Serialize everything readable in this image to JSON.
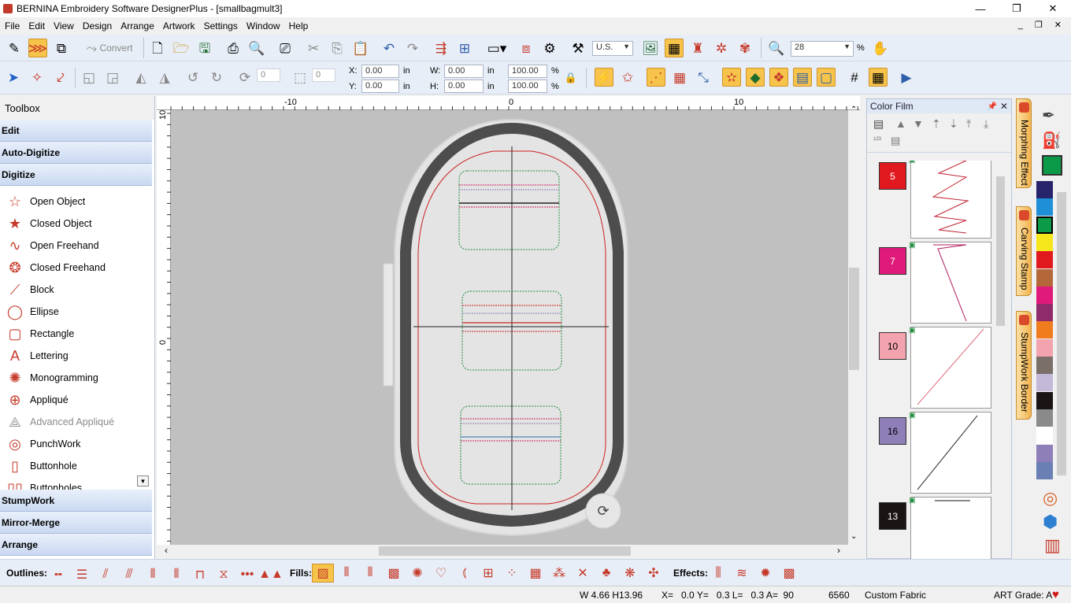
{
  "window": {
    "title": "BERNINA Embroidery Software DesignerPlus - [smallbagmult3]",
    "minimize": "—",
    "maximize": "❐",
    "close": "✕"
  },
  "menu": [
    "File",
    "Edit",
    "View",
    "Design",
    "Arrange",
    "Artwork",
    "Settings",
    "Window",
    "Help"
  ],
  "mdi_controls": "_ ❐ ✕",
  "toolbar1": {
    "convert_label": "Convert",
    "units": "U.S.",
    "zoom": "28",
    "zoom_unit": "%"
  },
  "toolbar2": {
    "x_label": "X:",
    "x_value": "0.00",
    "x_unit": "in",
    "y_label": "Y:",
    "y_value": "0.00",
    "y_unit": "in",
    "w_label": "W:",
    "w_value": "0.00",
    "w_unit": "in",
    "h_label": "H:",
    "h_value": "0.00",
    "h_unit": "in",
    "w_pct": "100.00",
    "h_pct": "100.00",
    "pct_unit": "%",
    "rotate_value": "0",
    "slant_value": "0"
  },
  "toolbox": {
    "title": "Toolbox",
    "sections_top": [
      "Edit",
      "Auto-Digitize",
      "Digitize"
    ],
    "tools": [
      {
        "label": "Open Object",
        "icon": "open-object-icon",
        "glyph": "☆",
        "disabled": false
      },
      {
        "label": "Closed Object",
        "icon": "closed-object-icon",
        "glyph": "★",
        "disabled": false
      },
      {
        "label": "Open Freehand",
        "icon": "open-freehand-icon",
        "glyph": "∿",
        "disabled": false
      },
      {
        "label": "Closed Freehand",
        "icon": "closed-freehand-icon",
        "glyph": "❂",
        "disabled": false
      },
      {
        "label": "Block",
        "icon": "block-icon",
        "glyph": "⟋",
        "disabled": false
      },
      {
        "label": "Ellipse",
        "icon": "ellipse-icon",
        "glyph": "◯",
        "disabled": false
      },
      {
        "label": "Rectangle",
        "icon": "rectangle-icon",
        "glyph": "▢",
        "disabled": false
      },
      {
        "label": "Lettering",
        "icon": "lettering-icon",
        "glyph": "A",
        "disabled": false
      },
      {
        "label": "Monogramming",
        "icon": "monogramming-icon",
        "glyph": "✺",
        "disabled": false
      },
      {
        "label": "Appliqué",
        "icon": "applique-icon",
        "glyph": "⊕",
        "disabled": false
      },
      {
        "label": "Advanced Appliqué",
        "icon": "advanced-applique-icon",
        "glyph": "⟁",
        "disabled": true
      },
      {
        "label": "PunchWork",
        "icon": "punchwork-icon",
        "glyph": "◎",
        "disabled": false
      },
      {
        "label": "Buttonhole",
        "icon": "buttonhole-icon",
        "glyph": "▯",
        "disabled": false
      },
      {
        "label": "Buttonholes",
        "icon": "buttonholes-icon",
        "glyph": "▯▯",
        "disabled": false
      }
    ],
    "sections_bottom": [
      "StumpWork",
      "Mirror-Merge",
      "Arrange"
    ]
  },
  "ruler": {
    "top_labels": [
      "-10",
      "0",
      "10"
    ],
    "left_labels": [
      "10",
      "0"
    ]
  },
  "color_film": {
    "title": "Color Film",
    "items": [
      {
        "number": "5",
        "color": "#e0191f",
        "text_color": "#ffffff"
      },
      {
        "number": "7",
        "color": "#e01a7a",
        "text_color": "#ffffff"
      },
      {
        "number": "10",
        "color": "#f2a3ad",
        "text_color": "#000000"
      },
      {
        "number": "16",
        "color": "#8e7fb8",
        "text_color": "#000000"
      },
      {
        "number": "13",
        "color": "#1b1414",
        "text_color": "#ffffff"
      }
    ]
  },
  "side_tabs": [
    "Morphing Effect",
    "Carving Stamp",
    "StumpWork Border"
  ],
  "palette": {
    "current": "#0a9a48",
    "colors": [
      "#27246b",
      "#1f8fd8",
      "#0a9a48",
      "#f5e71c",
      "#e0191f",
      "#b4683a",
      "#e01a7a",
      "#8f2b6a",
      "#f07c1e",
      "#f2a3ad",
      "#7b6f69",
      "#c3b9d9",
      "#1b1414",
      "#8a8a8a",
      "#ffffff",
      "#8e7fb8",
      "#6a7fb3"
    ]
  },
  "stitchbar": {
    "outlines_label": "Outlines:",
    "fills_label": "Fills:",
    "effects_label": "Effects:"
  },
  "status": {
    "size": "W 4.66 H13.96",
    "coords": "X=   0.0 Y=   0.3 L=   0.3 A=  90",
    "stitches": "6560",
    "fabric": "Custom Fabric",
    "grade": "ART Grade: A"
  }
}
